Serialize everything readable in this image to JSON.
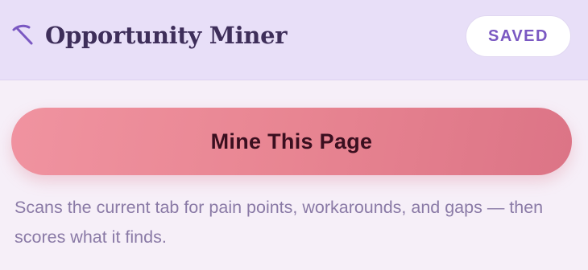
{
  "header": {
    "logo_icon": "pickaxe-icon",
    "title": "Opportunity Miner",
    "status_badge": "SAVED"
  },
  "main": {
    "primary_button_label": "Mine This Page",
    "description": "Scans the current tab for pain points, workarounds, and gaps — then scores what it finds."
  },
  "colors": {
    "header_bg": "#e8dff8",
    "page_bg": "#f6eff8",
    "title_text": "#3e2e5a",
    "badge_text": "#7a58c2",
    "button_gradient_start": "#f093a0",
    "button_gradient_end": "#dc7486",
    "button_text": "#3a0f1f",
    "description_text": "#8a7aa6"
  }
}
